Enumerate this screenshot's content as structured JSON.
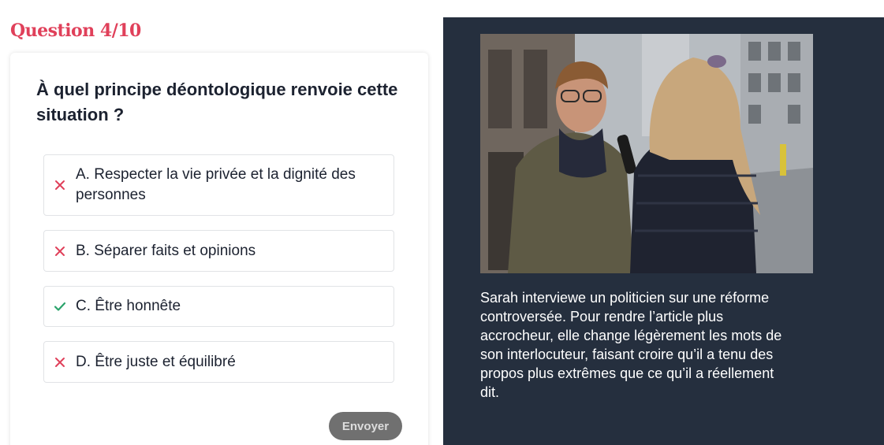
{
  "quiz": {
    "counter": "Question 4/10",
    "question": "À quel principe déontologique renvoie cette situation ?",
    "options": [
      {
        "label": "A. Respecter la vie privée et la dignité des personnes",
        "state": "incorrect",
        "icon": "cross-icon"
      },
      {
        "label": "B. Séparer faits et opinions",
        "state": "incorrect",
        "icon": "cross-icon"
      },
      {
        "label": "C. Être honnête",
        "state": "correct",
        "icon": "check-icon"
      },
      {
        "label": "D. Être juste et équilibré",
        "state": "incorrect",
        "icon": "cross-icon"
      }
    ],
    "submit_label": "Envoyer"
  },
  "scenario": {
    "photo_description": "journalist interviewing a politician on a street",
    "caption": "Sarah interviewe un politicien sur une réforme controversée. Pour rendre l’article plus accrocheur, elle change légèrement les mots de son interlocuteur, faisant croire qu’il a tenu des propos plus extrêmes que ce qu’il a réellement dit."
  },
  "colors": {
    "accent": "#e0405a",
    "incorrect": "#e0405a",
    "correct": "#2aa36b",
    "panel_bg": "#252f3e",
    "button_bg": "#707070"
  }
}
